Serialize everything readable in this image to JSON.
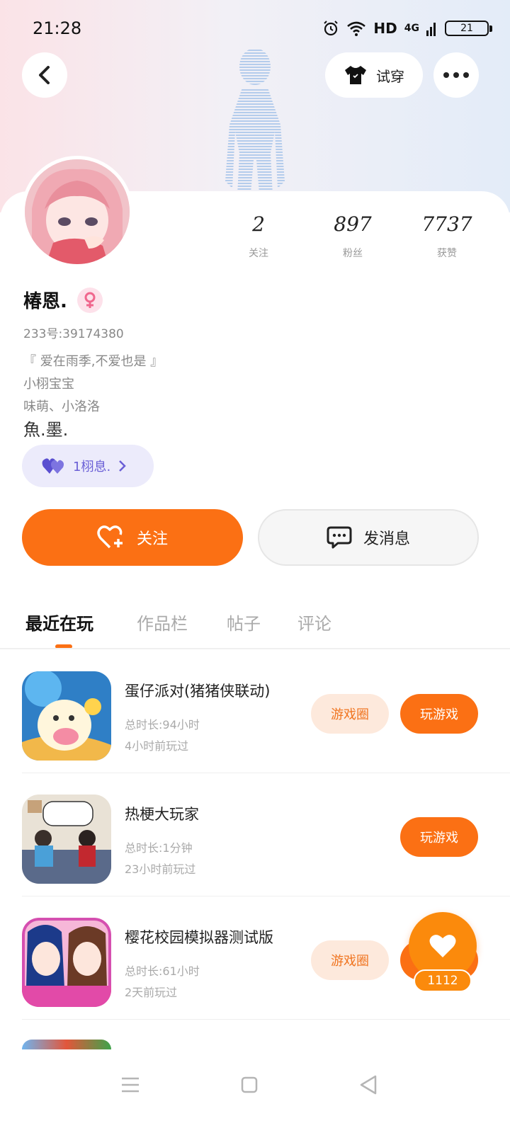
{
  "status_bar": {
    "time": "21:28",
    "network": "HD",
    "signal": "4G",
    "battery": "21"
  },
  "header": {
    "tryon_label": "试穿"
  },
  "profile": {
    "stats": [
      {
        "value": "2",
        "label": "关注"
      },
      {
        "value": "897",
        "label": "粉丝"
      },
      {
        "value": "7737",
        "label": "获赞"
      }
    ],
    "username": "椿恩.",
    "uid": "233号:39174380",
    "bio_lines": [
      "『 爱在雨季,不爱也是 』",
      "小栩宝宝",
      "味萌、小洛洛"
    ],
    "bio_big": "魚.墨.",
    "fans_pill": "1栩息."
  },
  "actions": {
    "follow": "关注",
    "message": "发消息"
  },
  "tabs": [
    "最近在玩",
    "作品栏",
    "帖子",
    "评论"
  ],
  "games": [
    {
      "title": "蛋仔派对(猪猪侠联动)",
      "duration": "总时长:94小时",
      "last_played": "4小时前玩过",
      "circle": "游戏圈",
      "play": "玩游戏"
    },
    {
      "title": "热梗大玩家",
      "duration": "总时长:1分钟",
      "last_played": "23小时前玩过",
      "circle": "",
      "play": "玩游戏"
    },
    {
      "title": "樱花校园模拟器测试版",
      "duration": "总时长:61小时",
      "last_played": "2天前玩过",
      "circle": "游戏圈",
      "play": "玩游戏"
    }
  ],
  "fab": {
    "count": "1112"
  },
  "colors": {
    "accent": "#fb7014",
    "pill_bg": "#fde9dc",
    "fans_bg": "#ecebfb"
  }
}
